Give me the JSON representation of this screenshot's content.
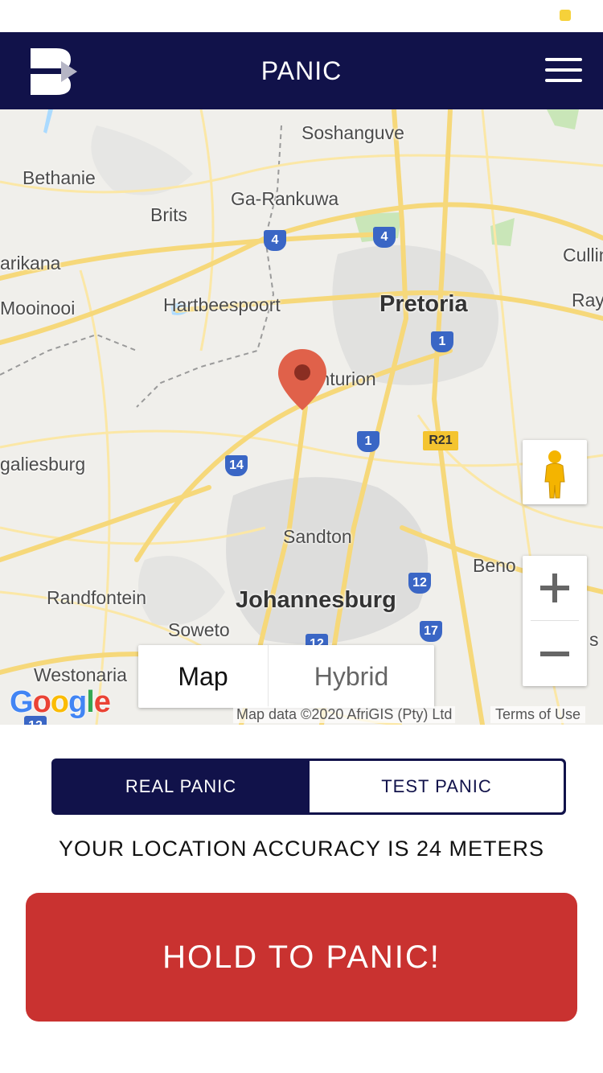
{
  "app": {
    "title": "PANIC",
    "icons": {
      "logo": "b-logo-icon",
      "menu": "hamburger-menu-icon"
    }
  },
  "map": {
    "places": [
      "Soshanguve",
      "Bethanie",
      "Ga-Rankuwa",
      "Brits",
      "arikana",
      "Cullin",
      "Mooinooi",
      "Hartbeespoort",
      "Pretoria",
      "Ray",
      "Centurion",
      "galiesburg",
      "Sandton",
      "Beno",
      "Randfontein",
      "Johannesburg",
      "Soweto",
      "Westonaria",
      "s"
    ],
    "route_shields": [
      "4",
      "4",
      "1",
      "1",
      "R21",
      "14",
      "12",
      "17",
      "12",
      "12"
    ],
    "map_type_options": [
      "Map",
      "Hybrid"
    ],
    "selected_map_type": "Map",
    "provider_logo": "Google",
    "attribution": "Map data ©2020 AfriGIS (Pty) Ltd",
    "terms_link": "Terms of Use",
    "zoom_in_label": "+",
    "zoom_out_label": "−"
  },
  "panic_mode": {
    "options": [
      "REAL PANIC",
      "TEST PANIC"
    ],
    "selected": "REAL PANIC"
  },
  "accuracy_text": "YOUR LOCATION ACCURACY IS 24 METERS",
  "panic_button_label": "HOLD TO PANIC!",
  "colors": {
    "header": "#11124a",
    "panic": "#c93230",
    "pin": "#e0614a",
    "road": "#f6d87a"
  }
}
